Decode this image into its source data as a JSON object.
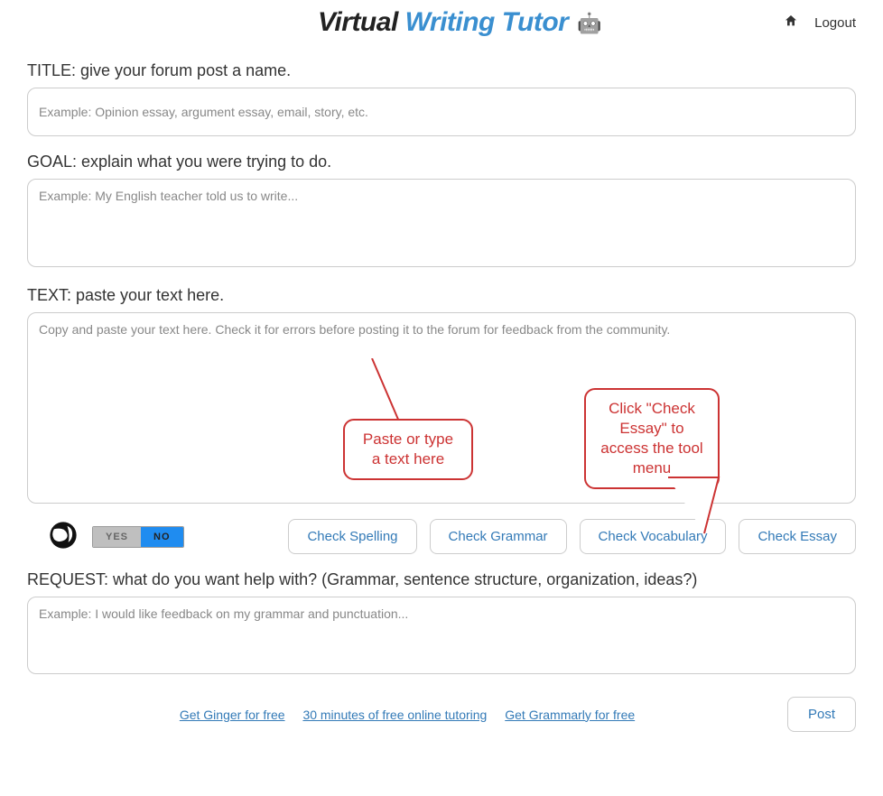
{
  "header": {
    "logo_left": "Virtual",
    "logo_right": "Writing Tutor",
    "logout": "Logout"
  },
  "title": {
    "label": "TITLE: give your forum post a name.",
    "placeholder": "Example: Opinion essay, argument essay, email, story, etc."
  },
  "goal": {
    "label": "GOAL: explain what you were trying to do.",
    "placeholder": "Example: My English teacher told us to write..."
  },
  "text": {
    "label": "TEXT: paste your text here.",
    "placeholder": "Copy and paste your text here. Check it for errors before posting it to the forum for feedback from the community."
  },
  "toolbar": {
    "toggle_yes": "YES",
    "toggle_no": "NO",
    "buttons": [
      "Check Spelling",
      "Check Grammar",
      "Check Vocabulary",
      "Check Essay"
    ]
  },
  "request": {
    "label": "REQUEST: what do you want help with? (Grammar, sentence structure, organization, ideas?)",
    "placeholder": "Example: I would like feedback on my grammar and punctuation..."
  },
  "footer": {
    "links": [
      "Get Ginger for free",
      "30 minutes of free online tutoring",
      "Get Grammarly for free"
    ],
    "post": "Post"
  },
  "callouts": {
    "c1": "Paste or type a text here",
    "c2": "Click \"Check Essay\" to access the tool menu"
  }
}
